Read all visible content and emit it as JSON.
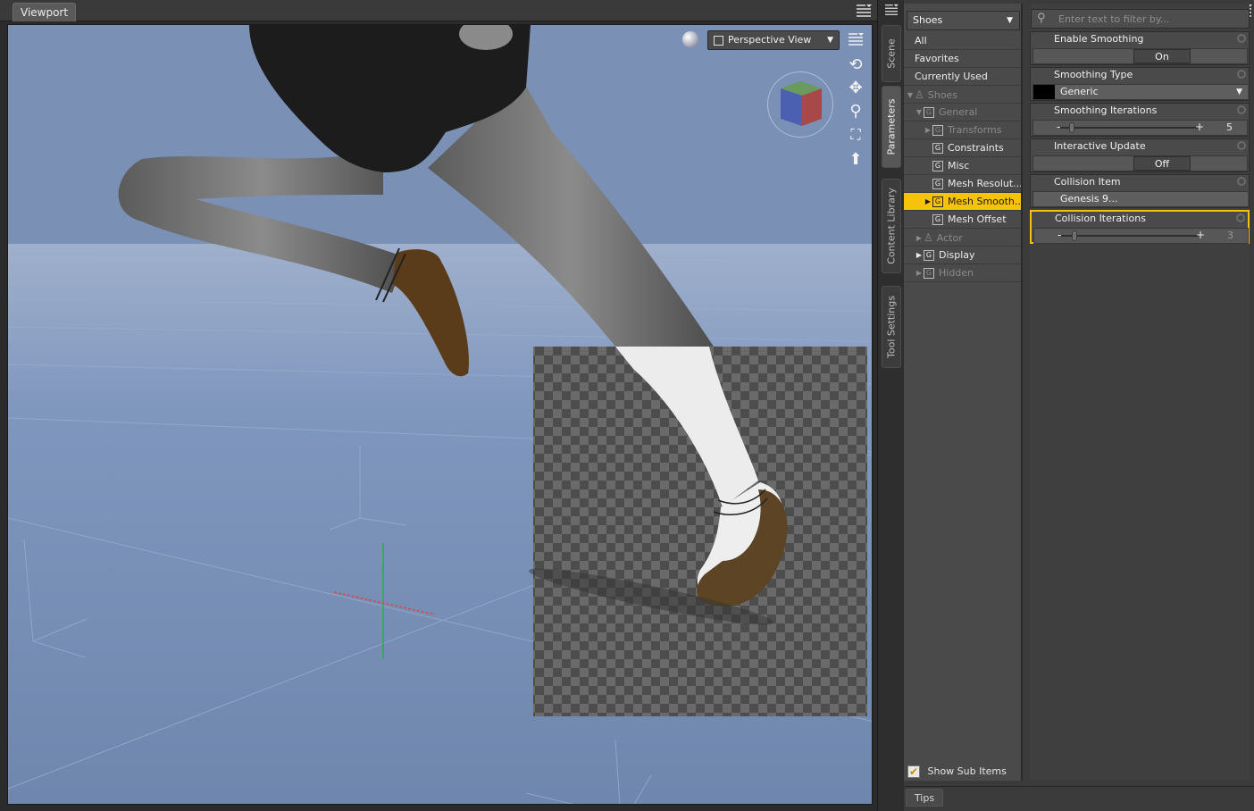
{
  "viewport": {
    "tab_label": "Viewport",
    "view_mode": "Perspective View",
    "tools": [
      "orbit-icon",
      "pan-icon",
      "zoom-icon",
      "frame-icon",
      "reset-icon"
    ]
  },
  "side_tabs": [
    "Scene",
    "Parameters",
    "Content Library",
    "Tool Settings"
  ],
  "parameters": {
    "node": "Shoes",
    "filter_placeholder": "Enter text to filter by...",
    "tree": [
      {
        "label": "All",
        "level": 0,
        "icon": "none",
        "style": "normal"
      },
      {
        "label": "Favorites",
        "level": 0,
        "icon": "none",
        "style": "normal"
      },
      {
        "label": "Currently Used",
        "level": 0,
        "icon": "none",
        "style": "normal"
      },
      {
        "label": "Shoes",
        "level": 0,
        "icon": "figure",
        "style": "dim",
        "expander": "open"
      },
      {
        "label": "General",
        "level": 1,
        "icon": "group",
        "style": "dim",
        "expander": "open"
      },
      {
        "label": "Transforms",
        "level": 2,
        "icon": "group",
        "style": "dim",
        "expander": "closed"
      },
      {
        "label": "Constraints",
        "level": 2,
        "icon": "group",
        "style": "normal"
      },
      {
        "label": "Misc",
        "level": 2,
        "icon": "group",
        "style": "normal"
      },
      {
        "label": "Mesh Resolut...",
        "level": 2,
        "icon": "group",
        "style": "normal"
      },
      {
        "label": "Mesh Smooth...",
        "level": 2,
        "icon": "group",
        "style": "selected",
        "expander": "closed"
      },
      {
        "label": "Mesh Offset",
        "level": 2,
        "icon": "group",
        "style": "normal"
      },
      {
        "label": "Actor",
        "level": 1,
        "icon": "figure",
        "style": "dim",
        "expander": "closed"
      },
      {
        "label": "Display",
        "level": 1,
        "icon": "group",
        "style": "normal",
        "expander": "closed"
      },
      {
        "label": "Hidden",
        "level": 1,
        "icon": "group",
        "style": "dim",
        "expander": "closed"
      }
    ],
    "properties": {
      "enable_smoothing": {
        "label": "Enable Smoothing",
        "value": "On"
      },
      "smoothing_type": {
        "label": "Smoothing Type",
        "value": "Generic"
      },
      "smoothing_iterations": {
        "label": "Smoothing Iterations",
        "value": "5"
      },
      "interactive_update": {
        "label": "Interactive Update",
        "value": "Off"
      },
      "collision_item": {
        "label": "Collision Item",
        "value": "Genesis 9..."
      },
      "collision_iterations": {
        "label": "Collision Iterations",
        "value": "3"
      }
    },
    "show_sub_items": "Show Sub Items",
    "tips_label": "Tips"
  },
  "colors": {
    "selection": "#f6c30a",
    "viewport_bg": "#7a90b5"
  }
}
